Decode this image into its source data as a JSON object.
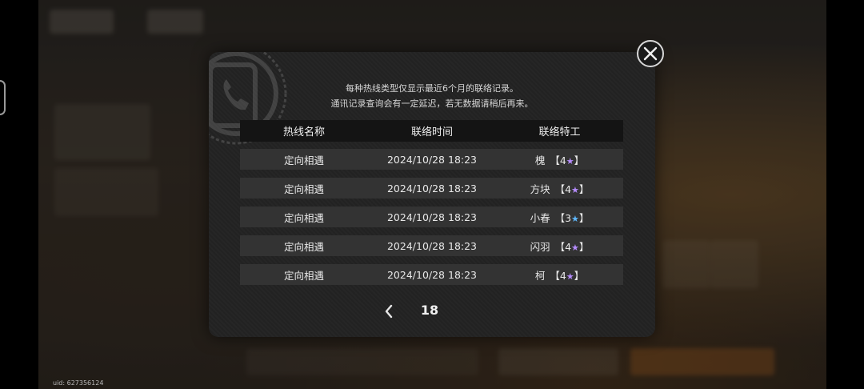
{
  "notice": {
    "line1": "每种热线类型仅显示最近6个月的联络记录。",
    "line2": "通讯记录查询会有一定延迟，若无数据请稍后再来。"
  },
  "table": {
    "headers": [
      "热线名称",
      "联络时间",
      "联络特工"
    ],
    "rows": [
      {
        "hotline": "定向相遇",
        "time": "2024/10/28 18:23",
        "agent": "槐",
        "rank": "4",
        "rank_color": "#b68cff"
      },
      {
        "hotline": "定向相遇",
        "time": "2024/10/28 18:23",
        "agent": "方块",
        "rank": "4",
        "rank_color": "#b68cff"
      },
      {
        "hotline": "定向相遇",
        "time": "2024/10/28 18:23",
        "agent": "小春",
        "rank": "3",
        "rank_color": "#5fb8ff"
      },
      {
        "hotline": "定向相遇",
        "time": "2024/10/28 18:23",
        "agent": "闪羽",
        "rank": "4",
        "rank_color": "#b68cff"
      },
      {
        "hotline": "定向相遇",
        "time": "2024/10/28 18:23",
        "agent": "柯",
        "rank": "4",
        "rank_color": "#b68cff"
      }
    ]
  },
  "pagination": {
    "page": "18",
    "prev_icon": "chevron-left-icon"
  },
  "close_icon": "close-icon",
  "uid_text": "uid: 627356124",
  "colors": {
    "dialog_bg": "#232323",
    "header_bg": "#141414",
    "row_bg": "#333333",
    "four_star": "#b68cff",
    "three_star": "#5fb8ff"
  }
}
